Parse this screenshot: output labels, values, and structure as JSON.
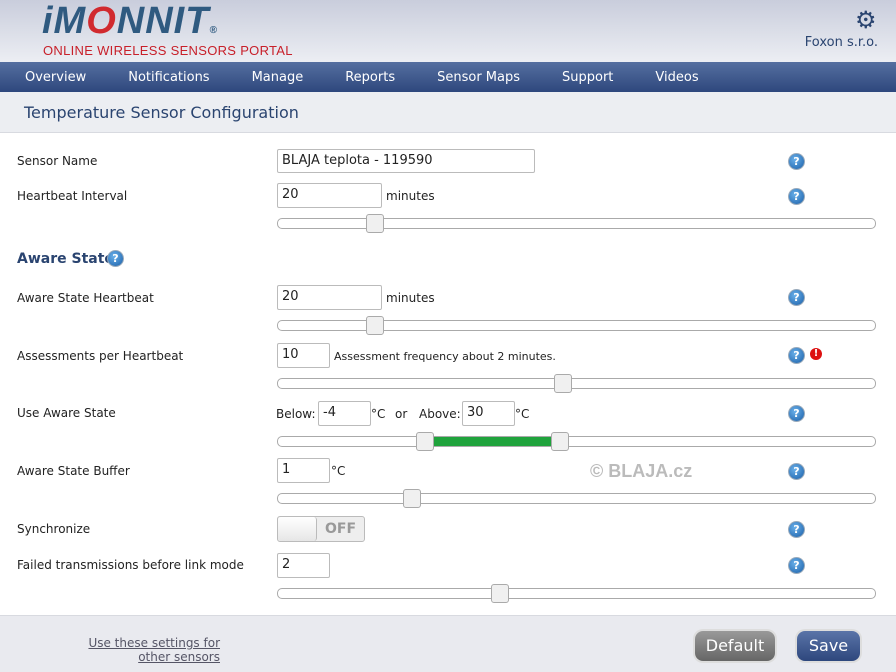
{
  "header": {
    "logo_prefix": "iM",
    "logo_o": "O",
    "logo_suffix": "NNIT",
    "logo_reg": "®",
    "tagline": "ONLINE WIRELESS SENSORS PORTAL",
    "organization": "Foxon s.r.o.",
    "settings_icon": "gear-icon"
  },
  "nav": [
    "Overview",
    "Notifications",
    "Manage",
    "Reports",
    "Sensor Maps",
    "Support",
    "Videos"
  ],
  "page_title": "Temperature Sensor Configuration",
  "form": {
    "sensor_name": {
      "label": "Sensor Name",
      "value": "BLAJA teplota - 119590"
    },
    "heartbeat": {
      "label": "Heartbeat Interval",
      "value": "20",
      "unit": "minutes",
      "slider_percent": 16
    },
    "aware_section": "Aware State",
    "aware_heartbeat": {
      "label": "Aware State Heartbeat",
      "value": "20",
      "unit": "minutes",
      "slider_percent": 16
    },
    "assessments": {
      "label": "Assessments per Heartbeat",
      "value": "10",
      "note": "Assessment frequency about 2 minutes.",
      "slider_percent": 47.6,
      "warning_icon": "!"
    },
    "use_aware": {
      "label": "Use Aware State",
      "below_label": "Below:",
      "below_value": "-4",
      "unit": "°C",
      "or": "or",
      "above_label": "Above:",
      "above_value": "30",
      "slider_low_percent": 24.4,
      "slider_high_percent": 47.1,
      "range_color": "#1fa33c"
    },
    "buffer": {
      "label": "Aware State Buffer",
      "value": "1",
      "unit": "°C",
      "slider_percent": 22.2
    },
    "synchronize": {
      "label": "Synchronize",
      "state": "OFF"
    },
    "failed": {
      "label": "Failed transmissions before link mode",
      "value": "2",
      "slider_percent": 37
    }
  },
  "help_glyph": "?",
  "watermark": "© BLAJA.cz",
  "footer": {
    "link": "Use these settings for other sensors",
    "default": "Default",
    "save": "Save"
  }
}
